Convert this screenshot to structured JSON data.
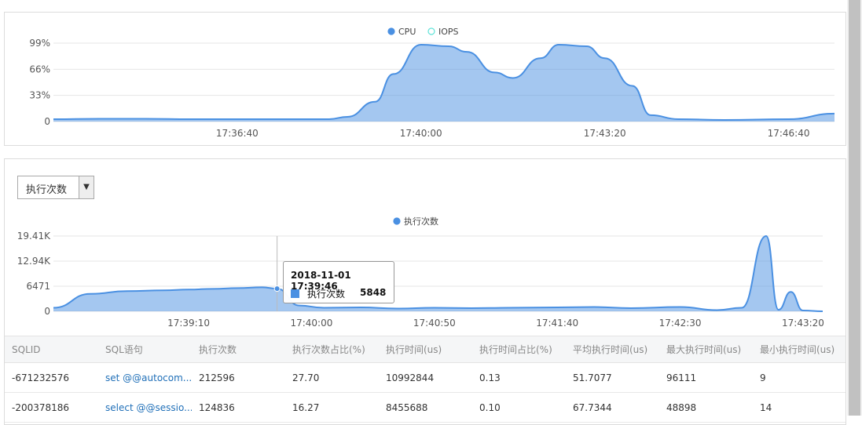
{
  "top_chart": {
    "legend": [
      {
        "name": "CPU",
        "color": "#4a90e2"
      },
      {
        "name": "IOPS",
        "color": "#5fe3d8"
      }
    ],
    "y_ticks": [
      "99%",
      "66%",
      "33%",
      "0"
    ],
    "x_ticks": [
      "17:36:40",
      "17:40:00",
      "17:43:20",
      "17:46:40"
    ]
  },
  "bottom_chart": {
    "metric_select": {
      "value": "执行次数",
      "icon": "chevron-down-icon"
    },
    "legend": [
      {
        "name": "执行次数",
        "color": "#4a90e2"
      }
    ],
    "y_ticks": [
      "19.41K",
      "12.94K",
      "6471",
      "0"
    ],
    "x_ticks": [
      "17:39:10",
      "17:40:00",
      "17:40:50",
      "17:41:40",
      "17:42:30",
      "17:43:20"
    ],
    "tooltip": {
      "time": "2018-11-01 17:39:46",
      "series": "执行次数",
      "value": "5848"
    }
  },
  "chart_data": [
    {
      "type": "area",
      "series": [
        {
          "name": "CPU",
          "x": [
            "17:33:20",
            "17:34:10",
            "17:35:00",
            "17:35:50",
            "17:36:40",
            "17:37:30",
            "17:38:20",
            "17:38:40",
            "17:39:10",
            "17:39:30",
            "17:40:00",
            "17:40:30",
            "17:40:50",
            "17:41:20",
            "17:41:40",
            "17:42:10",
            "17:42:30",
            "17:43:00",
            "17:43:20",
            "17:43:50",
            "17:44:10",
            "17:44:40",
            "17:45:30",
            "17:46:40",
            "17:47:30"
          ],
          "values": [
            3,
            3.5,
            3.5,
            3,
            3,
            3,
            3,
            6,
            25,
            60,
            97,
            95,
            88,
            62,
            55,
            80,
            97,
            95,
            80,
            45,
            8,
            3,
            2,
            3,
            10
          ]
        },
        {
          "name": "IOPS",
          "values": []
        }
      ],
      "ylabel": "",
      "xlabel": "",
      "ylim": [
        0,
        99
      ],
      "grid": true,
      "legend": "top-center"
    },
    {
      "type": "area",
      "series": [
        {
          "name": "执行次数",
          "x": [
            "17:38:15",
            "17:38:30",
            "17:38:45",
            "17:39:00",
            "17:39:10",
            "17:39:20",
            "17:39:30",
            "17:39:40",
            "17:39:46",
            "17:39:55",
            "17:40:05",
            "17:40:20",
            "17:40:35",
            "17:40:50",
            "17:41:05",
            "17:41:20",
            "17:41:40",
            "17:41:55",
            "17:42:10",
            "17:42:30",
            "17:42:45",
            "17:42:55",
            "17:43:05",
            "17:43:10",
            "17:43:15",
            "17:43:20",
            "17:43:28"
          ],
          "values": [
            900,
            4500,
            5200,
            5400,
            5600,
            5800,
            6000,
            6200,
            5848,
            1500,
            900,
            1000,
            700,
            900,
            800,
            900,
            1000,
            1100,
            800,
            1100,
            300,
            900,
            19410,
            400,
            5000,
            200,
            0
          ]
        }
      ],
      "ylabel": "",
      "xlabel": "",
      "ylim": [
        0,
        19410
      ],
      "grid": true,
      "legend": "top-center"
    }
  ],
  "table": {
    "columns": [
      "SQLID",
      "SQL语句",
      "执行次数",
      "执行次数占比(%)",
      "执行时间(us)",
      "执行时间占比(%)",
      "平均执行时间(us)",
      "最大执行时间(us)",
      "最小执行时间(us)"
    ],
    "rows": [
      [
        "-671232576",
        "set @@autocom...",
        "212596",
        "27.70",
        "10992844",
        "0.13",
        "51.7077",
        "96111",
        "9"
      ],
      [
        "-200378186",
        "select @@sessio...",
        "124836",
        "16.27",
        "8455688",
        "0.10",
        "67.7344",
        "48898",
        "14"
      ]
    ]
  }
}
